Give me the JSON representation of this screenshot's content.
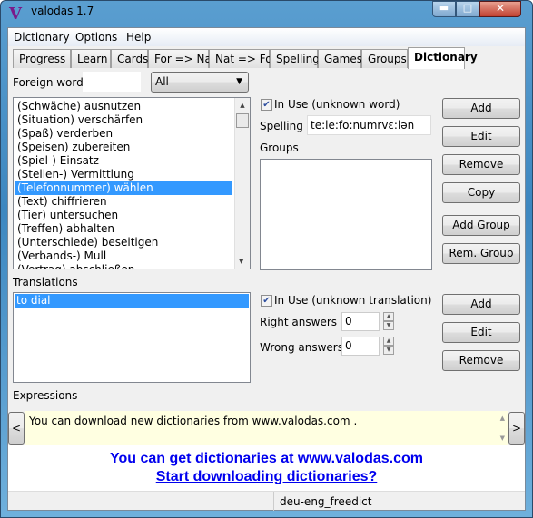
{
  "window": {
    "title": "valodas 1.7",
    "logo": "V"
  },
  "menu": [
    "Dictionary",
    "Options",
    "Help"
  ],
  "tabs": [
    "Progress",
    "Learn",
    "Cards",
    "For => Nat",
    "Nat => For",
    "Spelling",
    "Games",
    "Groups",
    "Dictionary"
  ],
  "active_tab": "Dictionary",
  "filter": {
    "label": "Foreign word",
    "value": "",
    "select": "All"
  },
  "words": [
    "(Schwäche) ausnutzen",
    "(Situation) verschärfen",
    "(Spaß) verderben",
    "(Speisen) zubereiten",
    "(Spiel-) Einsatz",
    "(Stellen-) Vermittlung",
    "(Telefonnummer) wählen",
    "(Text) chiffrieren",
    "(Tier) untersuchen",
    "(Treffen) abhalten",
    "(Unterschiede) beseitigen",
    "(Verbands-) Mull",
    "(Vertrag) abschließen"
  ],
  "selected_word_index": 6,
  "word_detail": {
    "in_use_label": "In Use (unknown word)",
    "in_use": true,
    "spelling_label": "Spelling",
    "spelling": "te:le:fo:numrvɛ:lən",
    "groups_label": "Groups"
  },
  "word_buttons": [
    "Add",
    "Edit",
    "Remove",
    "Copy",
    "Add Group",
    "Rem. Group"
  ],
  "translations": {
    "label": "Translations",
    "items": [
      "to dial"
    ],
    "in_use_label": "In Use (unknown translation)",
    "in_use": true,
    "right_label": "Right answers",
    "right": "0",
    "wrong_label": "Wrong answers",
    "wrong": "0"
  },
  "translation_buttons": [
    "Add",
    "Edit",
    "Remove"
  ],
  "expressions": {
    "label": "Expressions"
  },
  "info": {
    "text": "You can download new dictionaries from www.valodas.com .",
    "prev": "<",
    "next": ">"
  },
  "links": [
    "You can get dictionaries at www.valodas.com",
    "Start downloading dictionaries?"
  ],
  "status": {
    "dictionary": "deu-eng_freedict"
  }
}
